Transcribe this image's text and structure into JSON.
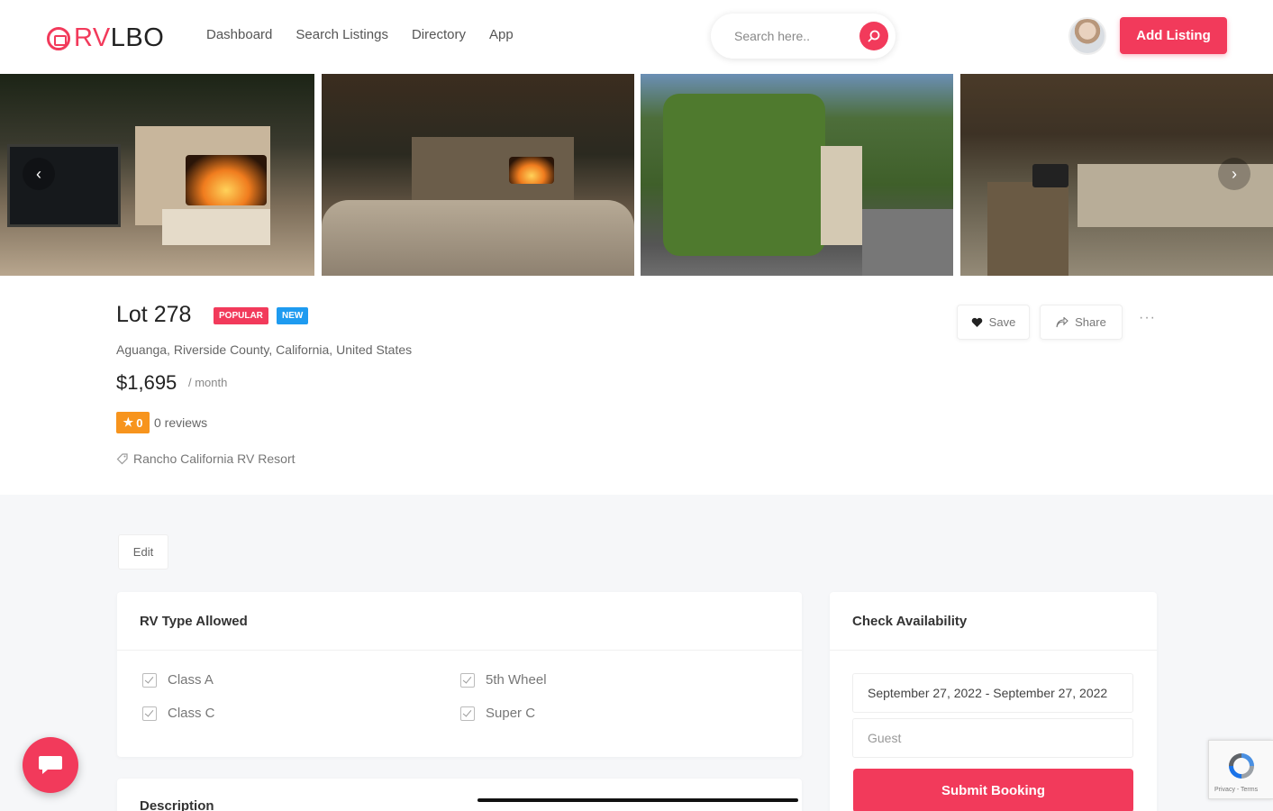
{
  "brand": {
    "logo_text_accent": "RV",
    "logo_text_rest": "LBO",
    "accent_color": "#f23a5b"
  },
  "nav": {
    "items": [
      "Dashboard",
      "Search Listings",
      "Directory",
      "App"
    ]
  },
  "search": {
    "placeholder": "Search here.."
  },
  "header": {
    "add_listing_label": "Add Listing"
  },
  "gallery": {
    "photos": [
      "outdoor-fireplace-tv",
      "patio-lounge-fireplace",
      "hedge-entrance-gazebo",
      "outdoor-kitchen-gazebo"
    ],
    "prev_arrow": "‹",
    "next_arrow": "›"
  },
  "listing": {
    "title": "Lot 278",
    "badges": {
      "popular": "POPULAR",
      "new": "NEW"
    },
    "location": "Aguanga, Riverside County, California, United States",
    "price": "$1,695",
    "price_period": "/ month",
    "rating": "0",
    "reviews": "0 reviews",
    "tag": "Rancho California RV Resort"
  },
  "actions": {
    "save": "Save",
    "share": "Share",
    "more": "···"
  },
  "edit_label": "Edit",
  "rv_types": {
    "title": "RV Type Allowed",
    "items": [
      "Class A",
      "5th Wheel",
      "Class C",
      "Super C"
    ]
  },
  "description": {
    "title": "Description"
  },
  "availability": {
    "title": "Check Availability",
    "date_range": "September 27, 2022 - September 27, 2022",
    "guest_placeholder": "Guest",
    "submit_label": "Submit Booking"
  },
  "recaptcha": {
    "footer": "Privacy - Terms"
  }
}
